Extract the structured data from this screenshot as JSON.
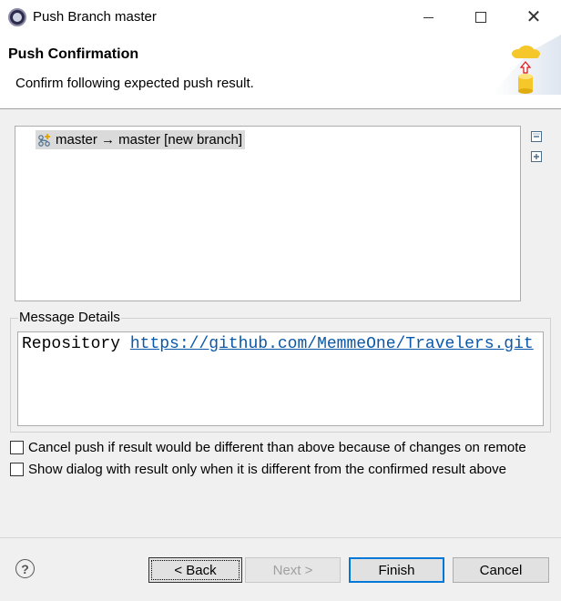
{
  "window": {
    "title": "Push Branch master"
  },
  "banner": {
    "title": "Push Confirmation",
    "message": "Confirm following expected push result."
  },
  "tree": {
    "items": [
      {
        "label": "master → master [new branch]",
        "icon": "new-branch-icon"
      }
    ],
    "collapse_all_icon": "collapse-all-icon",
    "expand_all_icon": "expand-all-icon"
  },
  "message_details": {
    "legend": "Message Details",
    "label": "Repository",
    "url": "https://github.com/MemmeOne/Travelers.git"
  },
  "options": [
    {
      "label": "Cancel push if result would be different than above because of changes on remote",
      "checked": false
    },
    {
      "label": "Show dialog with result only when it is different from the confirmed result above",
      "checked": false
    }
  ],
  "buttons": {
    "help": "?",
    "back": "< Back",
    "next": "Next >",
    "finish": "Finish",
    "cancel": "Cancel"
  },
  "colors": {
    "link": "#0b58a8",
    "focus_border": "#0078d7"
  }
}
